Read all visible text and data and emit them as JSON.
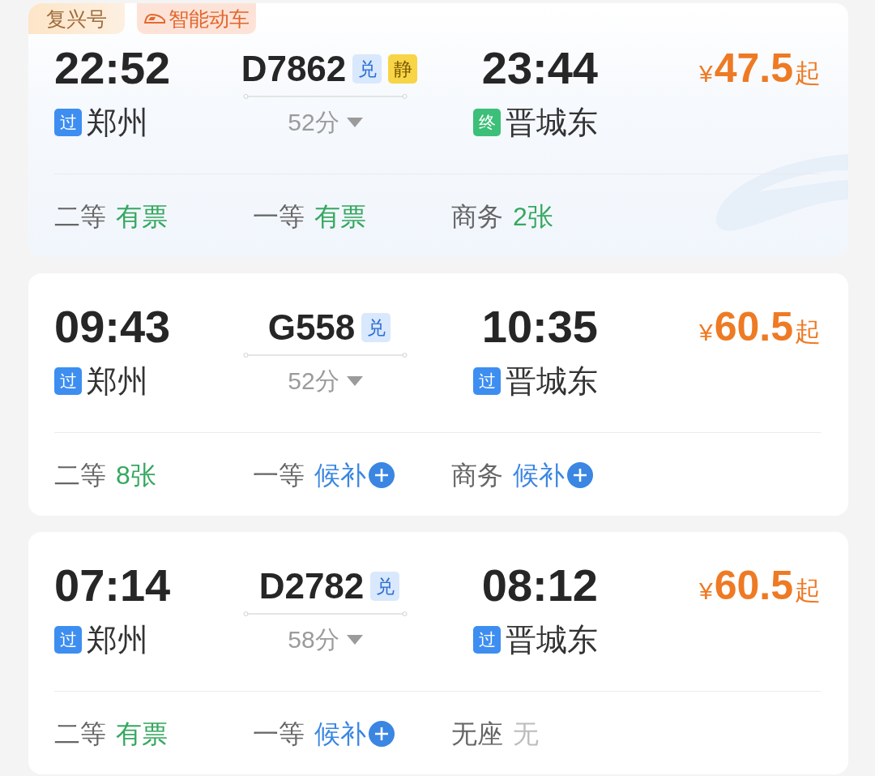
{
  "trains": [
    {
      "featured": true,
      "tags": [
        {
          "kind": "brand",
          "label": "复兴号"
        },
        {
          "kind": "smart",
          "label": "智能动车"
        }
      ],
      "departure_time": "22:52",
      "departure_station": {
        "kind": "pass",
        "badge": "过",
        "name": "郑州"
      },
      "train_number": "D7862",
      "train_badges": [
        {
          "kind": "exchange",
          "label": "兑"
        },
        {
          "kind": "quiet",
          "label": "静"
        }
      ],
      "duration": "52分",
      "arrival_time": "23:44",
      "arrival_station": {
        "kind": "terminal",
        "badge": "终",
        "name": "晋城东"
      },
      "price": {
        "currency": "¥",
        "amount": "47.5",
        "suffix": "起"
      },
      "seats": [
        {
          "class": "二等",
          "kind": "available",
          "availability": "有票"
        },
        {
          "class": "一等",
          "kind": "available",
          "availability": "有票"
        },
        {
          "class": "商务",
          "kind": "available",
          "availability": "2张"
        }
      ]
    },
    {
      "featured": false,
      "departure_time": "09:43",
      "departure_station": {
        "kind": "pass",
        "badge": "过",
        "name": "郑州"
      },
      "train_number": "G558",
      "train_badges": [
        {
          "kind": "exchange",
          "label": "兑"
        }
      ],
      "duration": "52分",
      "arrival_time": "10:35",
      "arrival_station": {
        "kind": "pass",
        "badge": "过",
        "name": "晋城东"
      },
      "price": {
        "currency": "¥",
        "amount": "60.5",
        "suffix": "起"
      },
      "seats": [
        {
          "class": "二等",
          "kind": "available",
          "availability": "8张"
        },
        {
          "class": "一等",
          "kind": "waitlist",
          "availability": "候补"
        },
        {
          "class": "商务",
          "kind": "waitlist",
          "availability": "候补"
        }
      ]
    },
    {
      "featured": false,
      "departure_time": "07:14",
      "departure_station": {
        "kind": "pass",
        "badge": "过",
        "name": "郑州"
      },
      "train_number": "D2782",
      "train_badges": [
        {
          "kind": "exchange",
          "label": "兑"
        }
      ],
      "duration": "58分",
      "arrival_time": "08:12",
      "arrival_station": {
        "kind": "pass",
        "badge": "过",
        "name": "晋城东"
      },
      "price": {
        "currency": "¥",
        "amount": "60.5",
        "suffix": "起"
      },
      "seats": [
        {
          "class": "二等",
          "kind": "available",
          "availability": "有票"
        },
        {
          "class": "一等",
          "kind": "waitlist",
          "availability": "候补"
        },
        {
          "class": "无座",
          "kind": "none",
          "availability": "无"
        }
      ]
    }
  ]
}
